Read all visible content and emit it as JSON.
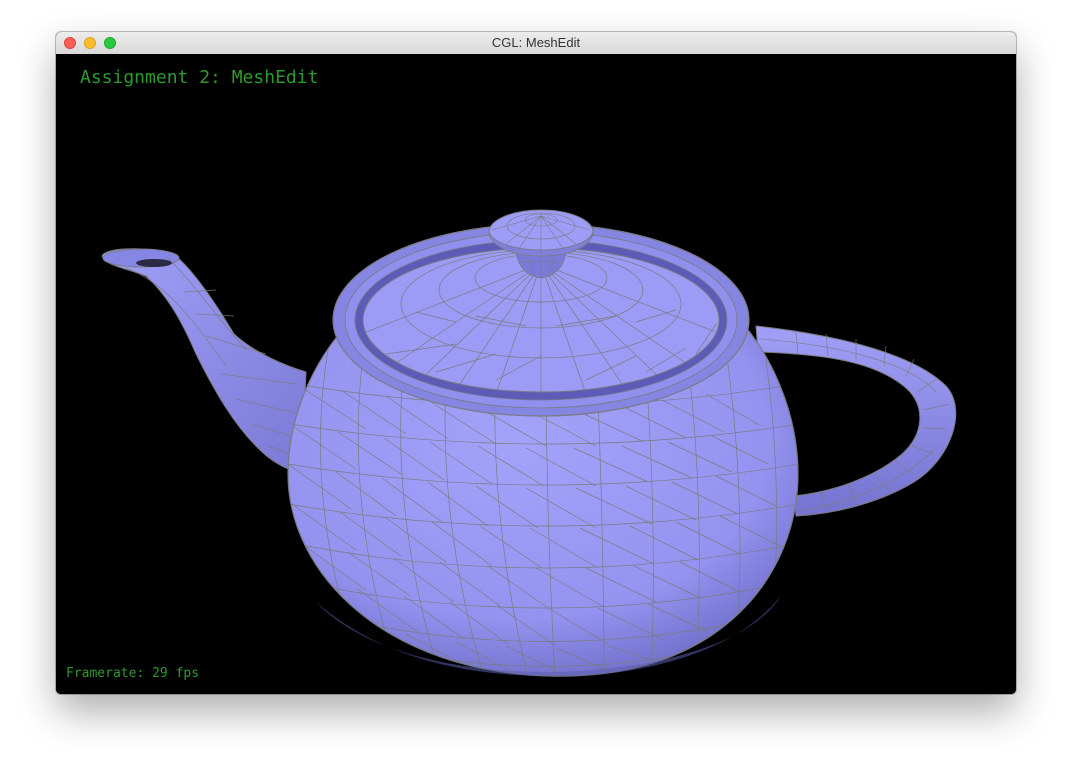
{
  "window": {
    "title": "CGL: MeshEdit"
  },
  "viewport": {
    "heading": "Assignment 2: MeshEdit",
    "framerate_text": "Framerate: 29 fps",
    "model": "teapot",
    "mesh_color": "#9a9af5",
    "wire_color": "#7a7a80",
    "text_color": "#2d9a2d"
  }
}
